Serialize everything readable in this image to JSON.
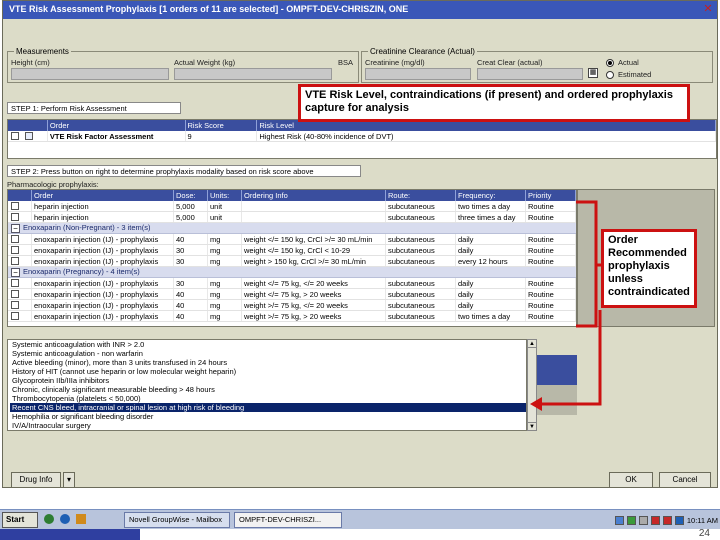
{
  "window": {
    "title": "VTE Risk Assessment  Prophylaxis  [1 orders of 11 are selected] - OMPFT-DEV-CHRISZIN, ONE",
    "close_glyph": "✕"
  },
  "measurements": {
    "legend": "Measurements",
    "height_label": "Height (cm)",
    "weight_label": "Actual Weight (kg)",
    "bsa_label": "BSA"
  },
  "creatinine": {
    "legend": "Creatinine Clearance (Actual)",
    "creatinine_label": "Creatinine (mg/dl)",
    "crcl_label": "Creat Clear (actual)",
    "actual_label": "Actual",
    "estimated_label": "Estimated"
  },
  "step1": {
    "label": "STEP 1: Perform Risk Assessment",
    "headers": [
      "Order",
      "Risk Score",
      "Risk Level"
    ],
    "row": [
      "VTE Risk Factor Assessment",
      "9",
      "Highest Risk (40-80% incidence of DVT)"
    ]
  },
  "step2": {
    "label": "STEP 2: Press button on right to determine prophylaxis modality based on risk score above",
    "pharm_label": "Pharmacologic prophylaxis:",
    "headers": [
      "Order",
      "Dose:",
      "Units:",
      "Ordering Info",
      "Route:",
      "Frequency:",
      "Priority"
    ],
    "heparin_rows": [
      [
        "heparin injection",
        "5,000",
        "unit",
        "",
        "subcutaneous",
        "two times a day",
        "Routine"
      ],
      [
        "heparin injection",
        "5,000",
        "unit",
        "",
        "subcutaneous",
        "three times a day",
        "Routine"
      ]
    ],
    "group1": "Enoxaparin (Non-Pregnant) - 3 item(s)",
    "group1_rows": [
      [
        "enoxaparin injection (IJ) - prophylaxis",
        "40",
        "mg",
        "weight </= 150 kg, CrCl >/= 30 mL/min",
        "subcutaneous",
        "daily",
        "Routine"
      ],
      [
        "enoxaparin injection (IJ) - prophylaxis",
        "30",
        "mg",
        "weight </= 150 kg, CrCl < 10-29",
        "subcutaneous",
        "daily",
        "Routine"
      ],
      [
        "enoxaparin injection (IJ) - prophylaxis",
        "30",
        "mg",
        "weight > 150 kg, CrCl >/= 30 mL/min",
        "subcutaneous",
        "every 12 hours",
        "Routine"
      ]
    ],
    "group2": "Enoxaparin (Pregnancy) - 4 item(s)",
    "group2_rows": [
      [
        "enoxaparin injection (IJ) - prophylaxis",
        "30",
        "mg",
        "weight </= 75 kg, </= 20 weeks",
        "subcutaneous",
        "daily",
        "Routine"
      ],
      [
        "enoxaparin injection (IJ) - prophylaxis",
        "40",
        "mg",
        "weight </= 75 kg, > 20 weeks",
        "subcutaneous",
        "daily",
        "Routine"
      ],
      [
        "enoxaparin injection (IJ) - prophylaxis",
        "40",
        "mg",
        "weight >/= 75 kg, </= 20 weeks",
        "subcutaneous",
        "daily",
        "Routine"
      ],
      [
        "enoxaparin injection (IJ) - prophylaxis",
        "40",
        "mg",
        "weight >/= 75 kg, > 20 weeks",
        "subcutaneous",
        "two times a day",
        "Routine"
      ]
    ]
  },
  "contraindications": {
    "items": [
      "Systemic anticoagulation with INR > 2.0",
      "Systemic anticoagulation - non warfarin",
      "Active bleeding (minor), more than 3 units transfused in 24 hours",
      "History of HIT (cannot use heparin or low molecular weight heparin)",
      "Glycoprotein IIb/IIIa inhibitors",
      "Chronic, clinically significant measurable bleeding > 48 hours",
      "Thrombocytopenia (platelets < 50,000)",
      "Recent CNS bleed, intracranial or spinal lesion at high risk of bleeding",
      "Hemophilia or significant bleeding disorder",
      "IV/A/Intraocular surgery"
    ],
    "selected_index": 7
  },
  "buttons": {
    "drug_info": "Drug Info",
    "ok": "OK",
    "cancel": "Cancel"
  },
  "callouts": {
    "top": "VTE Risk Level, contraindications (if present) and ordered prophylaxis capture for analysis",
    "right": "Order Recommended prophylaxis unless contraindicated"
  },
  "taskbar": {
    "start": "Start",
    "item1": "Novell GroupWise - Mailbox",
    "item2": "OMPFT-DEV-CHRISZI...",
    "clock": "10:11 AM"
  },
  "page_number": "24",
  "colors": {
    "title_bar": "#3a57b8",
    "grid_header": "#3a4e9e",
    "callout_border": "#cc1111",
    "selected_row": "#0a246a"
  }
}
